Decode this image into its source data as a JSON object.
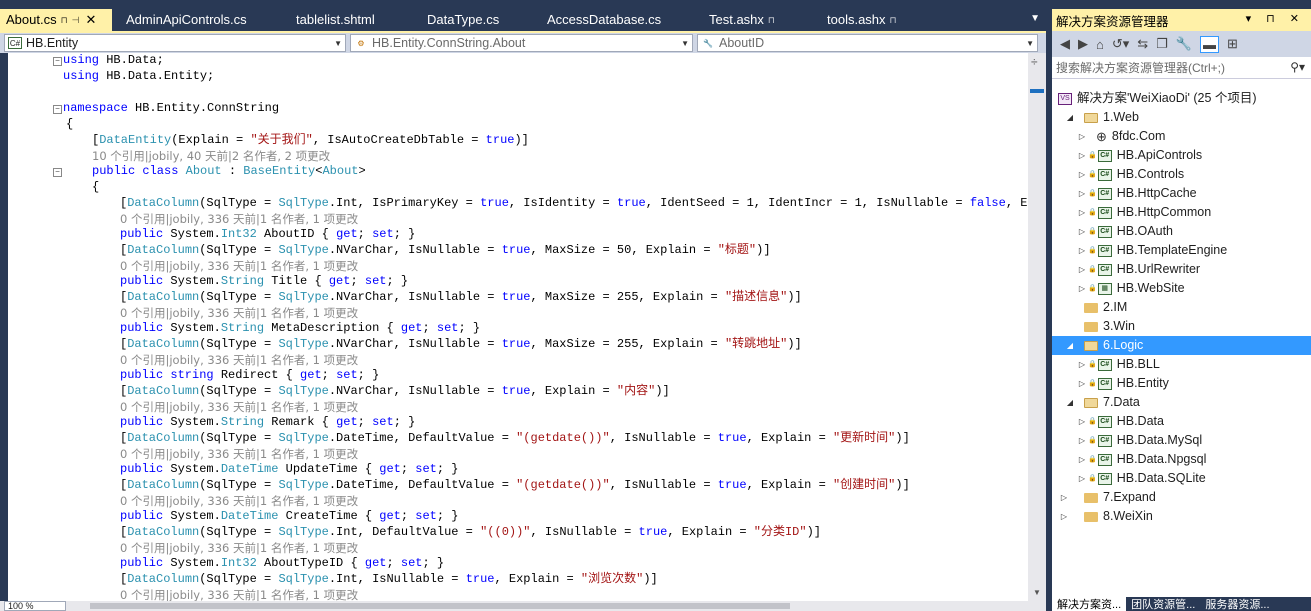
{
  "tabs": [
    {
      "label": "About.cs",
      "active": true,
      "pinned": true,
      "closable": true,
      "keep_open": true
    },
    {
      "label": "AdminApiControls.cs"
    },
    {
      "label": "tablelist.shtml"
    },
    {
      "label": "DataType.cs"
    },
    {
      "label": "AccessDatabase.cs"
    },
    {
      "label": "Test.ashx",
      "pinned": true
    },
    {
      "label": "tools.ashx",
      "pinned": true
    }
  ],
  "nav": {
    "project": "HB.Entity",
    "class": "HB.Entity.ConnString.About",
    "member": "AboutID"
  },
  "code": {
    "line1": "using HB.Data;",
    "line2": "using HB.Data.Entity;",
    "ns_kw": "namespace",
    "ns_name": " HB.Entity.ConnString",
    "brace_open": "{",
    "attr_class": "[DataEntity(Explain = \"关于我们\", IsAutoCreateDbTable = true)]",
    "lens_class": "10 个引用|jobily, 40 天前|2 名作者, 2 项更改",
    "class_decl_kw": "public class",
    "class_decl_name": " About",
    "class_decl_rest": " : BaseEntity<About>",
    "prop_attr_1": "[DataColumn(SqlType = SqlType.Int, IsPrimaryKey = true, IsIdentity = true, IdentSeed = 1, IdentIncr = 1, IsNullable = false, Expla",
    "lens_1": "0 个引用|jobily, 336 天前|1 名作者, 1 项更改",
    "prop_1": "public System.Int32 AboutID { get; set; }",
    "prop_attr_2": "[DataColumn(SqlType = SqlType.NVarChar, IsNullable = true, MaxSize = 50, Explain = \"标题\")]",
    "lens_2": "0 个引用|jobily, 336 天前|1 名作者, 1 项更改",
    "prop_2": "public System.String Title { get; set; }",
    "prop_attr_3": "[DataColumn(SqlType = SqlType.NVarChar, IsNullable = true, MaxSize = 255, Explain = \"描述信息\")]",
    "lens_3": "0 个引用|jobily, 336 天前|1 名作者, 1 项更改",
    "prop_3": "public System.String MetaDescription { get; set; }",
    "prop_attr_4": "[DataColumn(SqlType = SqlType.NVarChar, IsNullable = true, MaxSize = 255, Explain = \"转跳地址\")]",
    "lens_4": "0 个引用|jobily, 336 天前|1 名作者, 1 项更改",
    "prop_4": "public string Redirect { get; set; }",
    "prop_attr_5": "[DataColumn(SqlType = SqlType.NVarChar, IsNullable = true, Explain = \"内容\")]",
    "lens_5": "0 个引用|jobily, 336 天前|1 名作者, 1 项更改",
    "prop_5": "public System.String Remark { get; set; }",
    "prop_attr_6": "[DataColumn(SqlType = SqlType.DateTime, DefaultValue = \"(getdate())\", IsNullable = true, Explain = \"更新时间\")]",
    "lens_6": "0 个引用|jobily, 336 天前|1 名作者, 1 项更改",
    "prop_6": "public System.DateTime UpdateTime { get; set; }",
    "prop_attr_7": "[DataColumn(SqlType = SqlType.DateTime, DefaultValue = \"(getdate())\", IsNullable = true, Explain = \"创建时间\")]",
    "lens_7": "0 个引用|jobily, 336 天前|1 名作者, 1 项更改",
    "prop_7": "public System.DateTime CreateTime { get; set; }",
    "prop_attr_8": "[DataColumn(SqlType = SqlType.Int, DefaultValue = \"((0))\", IsNullable = true, Explain = \"分类ID\")]",
    "lens_8": "0 个引用|jobily, 336 天前|1 名作者, 1 项更改",
    "prop_8": "public System.Int32 AboutTypeID { get; set; }",
    "prop_attr_9": "[DataColumn(SqlType = SqlType.Int, IsNullable = true, Explain = \"浏览次数\")]",
    "lens_9": "0 个引用|jobily, 336 天前|1 名作者, 1 项更改"
  },
  "zoom": "100 %",
  "explorer": {
    "title": "解决方案资源管理器",
    "search_placeholder": "搜索解决方案资源管理器(Ctrl+;)",
    "solution": "解决方案'WeiXiaoDi' (25 个项目)",
    "items": [
      {
        "label": "1.Web",
        "type": "folder",
        "expanded": true
      },
      {
        "label": "8fdc.Com",
        "type": "globe"
      },
      {
        "label": "HB.ApiControls",
        "type": "cs"
      },
      {
        "label": "HB.Controls",
        "type": "cs"
      },
      {
        "label": "HB.HttpCache",
        "type": "cs"
      },
      {
        "label": "HB.HttpCommon",
        "type": "cs"
      },
      {
        "label": "HB.OAuth",
        "type": "cs"
      },
      {
        "label": "HB.TemplateEngine",
        "type": "cs"
      },
      {
        "label": "HB.UrlRewriter",
        "type": "cs"
      },
      {
        "label": "HB.WebSite",
        "type": "web"
      },
      {
        "label": "2.IM",
        "type": "folder"
      },
      {
        "label": "3.Win",
        "type": "folder"
      },
      {
        "label": "6.Logic",
        "type": "folder",
        "expanded": true,
        "selected": true
      },
      {
        "label": "HB.BLL",
        "type": "cs"
      },
      {
        "label": "HB.Entity",
        "type": "cs"
      },
      {
        "label": "7.Data",
        "type": "folder",
        "expanded": true
      },
      {
        "label": "HB.Data",
        "type": "cs"
      },
      {
        "label": "HB.Data.MySql",
        "type": "cs"
      },
      {
        "label": "HB.Data.Npgsql",
        "type": "cs"
      },
      {
        "label": "HB.Data.SQLite",
        "type": "cs"
      },
      {
        "label": "7.Expand",
        "type": "folder"
      },
      {
        "label": "8.WeiXin",
        "type": "folder"
      }
    ],
    "bottom_tabs": [
      "解决方案资...",
      "团队资源管...",
      "服务器资源..."
    ]
  }
}
